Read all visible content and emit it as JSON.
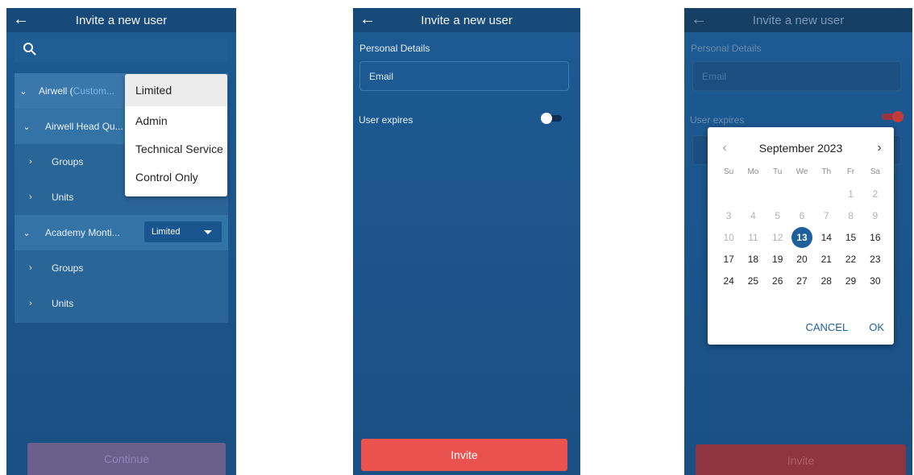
{
  "screen1": {
    "header": {
      "back_icon": "arrow-left-icon",
      "title": "Invite a new user"
    },
    "search": {
      "icon": "search-icon"
    },
    "tree": {
      "root": {
        "label": "Airwell (",
        "custom_label": "Custom..."
      },
      "head_quarters": {
        "label": "Airwell Head Qu..."
      },
      "groups_1": {
        "label": "Groups"
      },
      "units_1": {
        "label": "Units"
      },
      "academy": {
        "label": "Academy Monti...",
        "role_value": "Limited"
      },
      "groups_2": {
        "label": "Groups"
      },
      "units_2": {
        "label": "Units"
      }
    },
    "role_dropdown": {
      "options": [
        "Limited",
        "Admin",
        "Technical Service",
        "Control Only"
      ],
      "selected": "Limited"
    },
    "continue_label": "Continue",
    "colors": {
      "accent": "#1a5084",
      "continue_bg": "#6b5f8c"
    }
  },
  "screen2": {
    "header": {
      "back_icon": "arrow-left-icon",
      "title": "Invite a new user"
    },
    "section_label": "Personal Details",
    "email_placeholder": "Email",
    "user_expires_label": "User expires",
    "user_expires_on": false,
    "invite_label": "Invite",
    "colors": {
      "invite_bg": "#e9524e"
    }
  },
  "screen3": {
    "header": {
      "back_icon": "arrow-left-icon",
      "title": "Invite a new user"
    },
    "section_label": "Personal Details",
    "email_placeholder": "Email",
    "user_expires_label": "User expires",
    "user_expires_on": true,
    "invite_label": "Invite",
    "calendar": {
      "month_label": "September 2023",
      "weekdays": [
        "Su",
        "Mo",
        "Tu",
        "We",
        "Th",
        "Fr",
        "Sa"
      ],
      "weeks": [
        [
          "",
          "",
          "",
          "",
          "",
          "1",
          "2"
        ],
        [
          "3",
          "4",
          "5",
          "6",
          "7",
          "8",
          "9"
        ],
        [
          "10",
          "11",
          "12",
          "13",
          "14",
          "15",
          "16"
        ],
        [
          "17",
          "18",
          "19",
          "20",
          "21",
          "22",
          "23"
        ],
        [
          "24",
          "25",
          "26",
          "27",
          "28",
          "29",
          "30"
        ]
      ],
      "selected_day": "13",
      "cancel_label": "CANCEL",
      "ok_label": "OK",
      "colors": {
        "selected": "#1e5f9c"
      }
    }
  }
}
